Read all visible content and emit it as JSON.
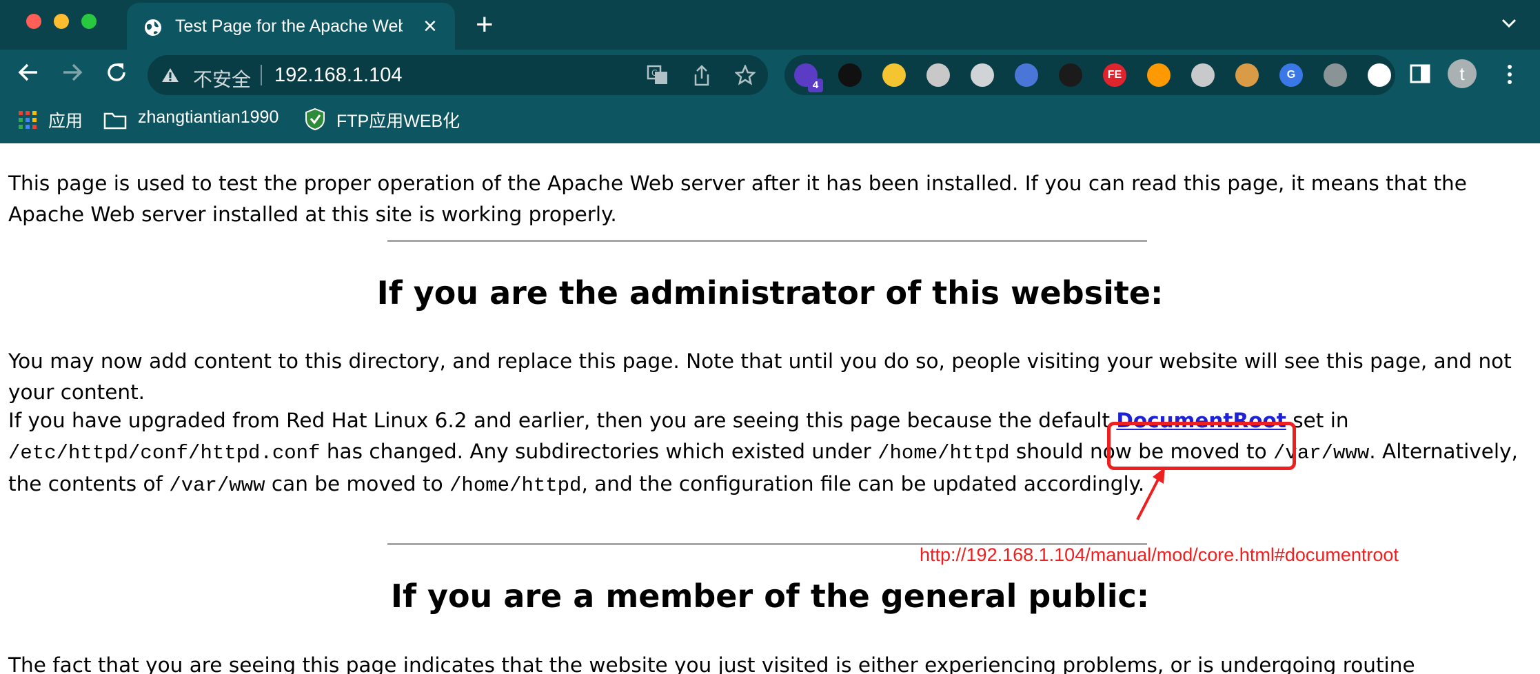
{
  "window": {
    "traffic_lights": [
      "#ff5f57",
      "#febc2e",
      "#28c840"
    ]
  },
  "tab": {
    "title": "Test Page for the Apache Web Server",
    "close_icon": "close-icon"
  },
  "toolbar": {
    "security_label": "不安全",
    "url": "192.168.1.104"
  },
  "extensions": [
    {
      "name": "ext-stacked-icon",
      "color": "#5b3cc4",
      "badge": "4"
    },
    {
      "name": "ext-glasses-icon",
      "color": "#111111"
    },
    {
      "name": "ext-r-icon",
      "color": "#f5c431"
    },
    {
      "name": "ext-command-icon",
      "color": "#c8c8c8"
    },
    {
      "name": "ext-globe-icon",
      "color": "#d0d4d6"
    },
    {
      "name": "ext-globe-blue-icon",
      "color": "#4a76d8"
    },
    {
      "name": "ext-hat-icon",
      "color": "#1b1b1b"
    },
    {
      "name": "ext-fe-icon",
      "color": "#e0242d",
      "text": "FE"
    },
    {
      "name": "ext-amazon-icon",
      "color": "#ff9900"
    },
    {
      "name": "ext-camera-icon",
      "color": "#c7c9cb"
    },
    {
      "name": "ext-cookie-icon",
      "color": "#d99b45"
    },
    {
      "name": "ext-translate-icon",
      "color": "#3b78e7",
      "text": "G"
    },
    {
      "name": "ext-gear-icon",
      "color": "#8a9396"
    },
    {
      "name": "puzzle-icon",
      "color": "#ffffff"
    }
  ],
  "profile": {
    "initial": "t"
  },
  "bookmarks": {
    "apps": "应用",
    "folder": "zhangtiantian1990",
    "ftp": "FTP应用WEB化"
  },
  "page": {
    "intro": "This page is used to test the proper operation of the Apache Web server after it has been installed. If you can read this page, it means that the Apache Web server installed at this site is working properly.",
    "heading_admin": "If you are the administrator of this website:",
    "admin_para1": "You may now add content to this directory, and replace this page. Note that until you do so, people visiting your website will see this page, and not your content.",
    "admin_para2": {
      "t1": "If you have upgraded from Red Hat Linux 6.2 and earlier, then you are seeing this page because the default ",
      "link": "DocumentRoot",
      "t2": " set in ",
      "c1": "/etc/httpd/conf/httpd.conf",
      "t3": " has changed. Any subdirectories which existed under ",
      "c2": "/home/httpd",
      "t4": " should now be moved to ",
      "c3": "/var/www",
      "t5": ". Alternatively, the contents of ",
      "c4": "/var/www",
      "t6": " can be moved to ",
      "c5": "/home/httpd",
      "t7": ", and the configuration file can be updated accordingly."
    },
    "heading_public": "If you are a member of the general public:",
    "public_para": "The fact that you are seeing this page indicates that the website you just visited is either experiencing problems, or is undergoing routine"
  },
  "annotation": {
    "url": "http://192.168.1.104/manual/mod/core.html#documentroot",
    "color": "#ee1f1f"
  }
}
